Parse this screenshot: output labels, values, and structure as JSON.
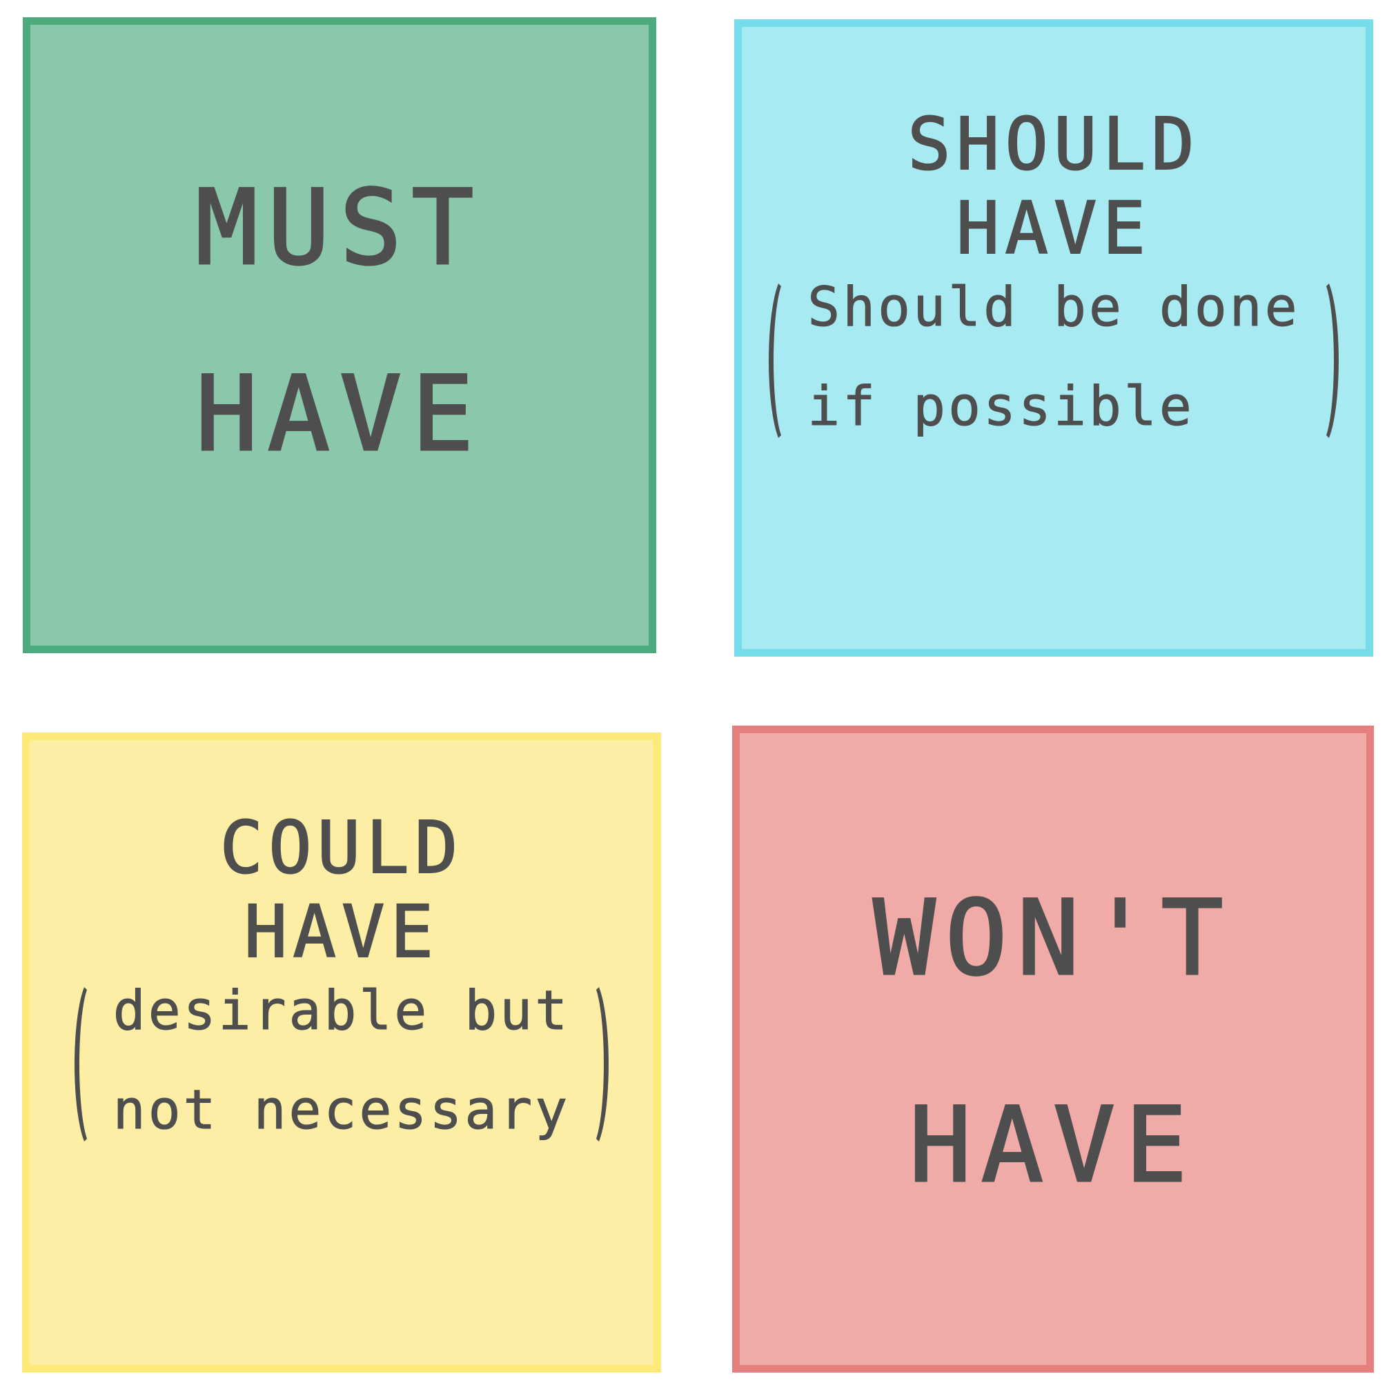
{
  "notes": {
    "must": {
      "line1": "MUST",
      "line2": "HAVE",
      "color": "#8ac7ab",
      "border": "#4dac7e"
    },
    "should": {
      "line1": "SHOULD",
      "line2": "HAVE",
      "note_line1": "Should be done",
      "note_line2": "if possible",
      "color": "#a8eaf1",
      "border": "#75dde9"
    },
    "could": {
      "line1": "COULD",
      "line2": "HAVE",
      "note_line1": "desirable but",
      "note_line2": "not necessary",
      "color": "#fcefa5",
      "border": "#fde977"
    },
    "wont": {
      "line1": "WON'T",
      "line2": "HAVE",
      "color": "#f0aaa8",
      "border": "#e47f7d"
    }
  }
}
